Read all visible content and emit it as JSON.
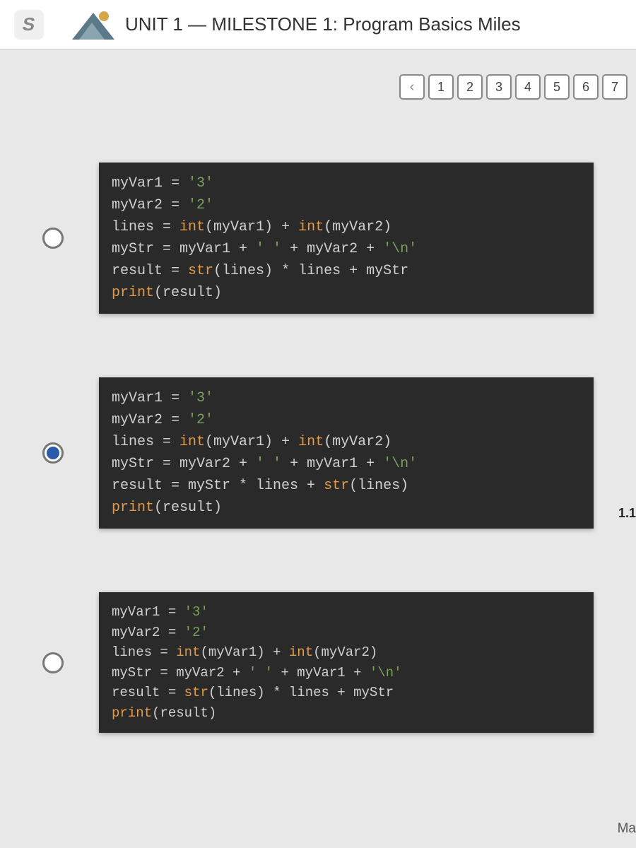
{
  "header": {
    "logo_glyph": "S",
    "title": "UNIT 1 — MILESTONE 1: Program Basics Miles"
  },
  "pager": {
    "prev": "‹",
    "items": [
      "1",
      "2",
      "3",
      "4",
      "5",
      "6",
      "7"
    ]
  },
  "options": [
    {
      "selected": false,
      "code": [
        [
          [
            "id",
            "myVar1"
          ],
          [
            "op",
            " = "
          ],
          [
            "str",
            "'3'"
          ]
        ],
        [
          [
            "id",
            "myVar2"
          ],
          [
            "op",
            " = "
          ],
          [
            "str",
            "'2'"
          ]
        ],
        [
          [
            "id",
            "lines"
          ],
          [
            "op",
            " = "
          ],
          [
            "func",
            "int"
          ],
          [
            "id",
            "(myVar1)"
          ],
          [
            "op",
            " + "
          ],
          [
            "func",
            "int"
          ],
          [
            "id",
            "(myVar2)"
          ]
        ],
        [
          [
            "id",
            "myStr"
          ],
          [
            "op",
            " = myVar1 + "
          ],
          [
            "str",
            "' '"
          ],
          [
            "op",
            " + myVar2 + "
          ],
          [
            "str",
            "'\\n'"
          ]
        ],
        [
          [
            "id",
            "result"
          ],
          [
            "op",
            " = "
          ],
          [
            "func",
            "str"
          ],
          [
            "id",
            "(lines)"
          ],
          [
            "op",
            " * lines + myStr"
          ]
        ],
        [
          [
            "func",
            "print"
          ],
          [
            "id",
            "(result)"
          ]
        ]
      ]
    },
    {
      "selected": true,
      "code": [
        [
          [
            "id",
            "myVar1"
          ],
          [
            "op",
            " = "
          ],
          [
            "str",
            "'3'"
          ]
        ],
        [
          [
            "id",
            "myVar2"
          ],
          [
            "op",
            " = "
          ],
          [
            "str",
            "'2'"
          ]
        ],
        [
          [
            "id",
            "lines"
          ],
          [
            "op",
            " = "
          ],
          [
            "func",
            "int"
          ],
          [
            "id",
            "(myVar1)"
          ],
          [
            "op",
            " + "
          ],
          [
            "func",
            "int"
          ],
          [
            "id",
            "(myVar2)"
          ]
        ],
        [
          [
            "id",
            "myStr"
          ],
          [
            "op",
            " = myVar2 + "
          ],
          [
            "str",
            "' '"
          ],
          [
            "op",
            " + myVar1 + "
          ],
          [
            "str",
            "'\\n'"
          ]
        ],
        [
          [
            "id",
            "result"
          ],
          [
            "op",
            " = myStr * lines + "
          ],
          [
            "func",
            "str"
          ],
          [
            "id",
            "(lines)"
          ]
        ],
        [
          [
            "func",
            "print"
          ],
          [
            "id",
            "(result)"
          ]
        ]
      ]
    },
    {
      "selected": false,
      "code": [
        [
          [
            "id",
            "myVar1"
          ],
          [
            "op",
            " = "
          ],
          [
            "str",
            "'3'"
          ]
        ],
        [
          [
            "id",
            "myVar2"
          ],
          [
            "op",
            " = "
          ],
          [
            "str",
            "'2'"
          ]
        ],
        [
          [
            "id",
            "lines"
          ],
          [
            "op",
            " = "
          ],
          [
            "func",
            "int"
          ],
          [
            "id",
            "(myVar1)"
          ],
          [
            "op",
            " + "
          ],
          [
            "func",
            "int"
          ],
          [
            "id",
            "(myVar2)"
          ]
        ],
        [
          [
            "id",
            "myStr"
          ],
          [
            "op",
            " = myVar2 + "
          ],
          [
            "str",
            "' '"
          ],
          [
            "op",
            " + myVar1 + "
          ],
          [
            "str",
            "'\\n'"
          ]
        ],
        [
          [
            "id",
            "result"
          ],
          [
            "op",
            " = "
          ],
          [
            "func",
            "str"
          ],
          [
            "id",
            "(lines)"
          ],
          [
            "op",
            " * lines + myStr"
          ]
        ],
        [
          [
            "func",
            "print"
          ],
          [
            "id",
            "(result)"
          ]
        ]
      ]
    }
  ],
  "side_note": "1.1",
  "bottom_note": "Ma"
}
